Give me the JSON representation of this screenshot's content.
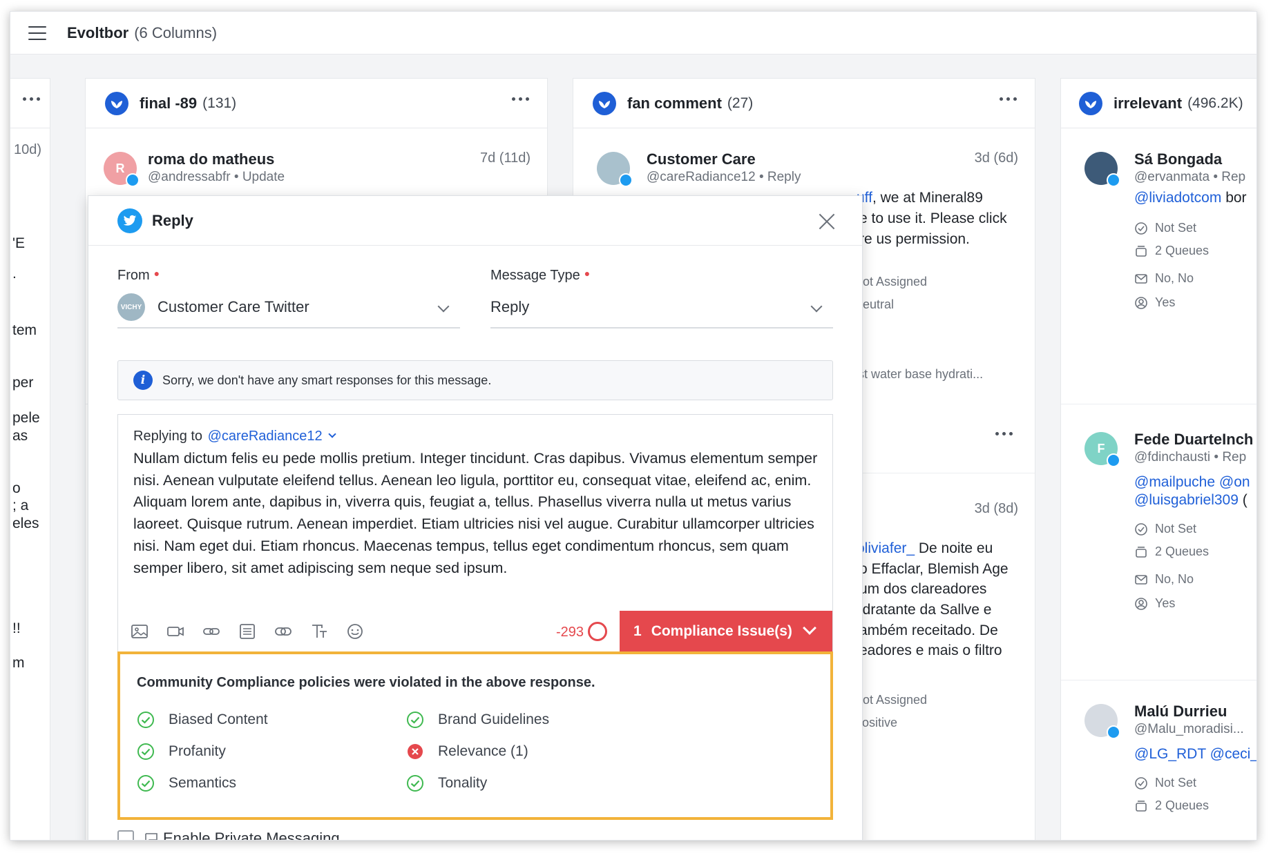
{
  "header": {
    "title": "Evoltbor",
    "subtitle": "(6 Columns)"
  },
  "left_column": {
    "time": "10d)",
    "fragments": [
      "'E",
      ".",
      "tem",
      "per",
      "pele",
      "as",
      "o",
      "; a",
      "eles",
      "!!",
      "m"
    ]
  },
  "columns": [
    {
      "title": "final -89",
      "count": "(131)",
      "cards": [
        {
          "initial": "R",
          "name": "roma do matheus",
          "handle": "@andressabfr • Update",
          "time": "7d (11d)"
        }
      ]
    },
    {
      "title": "fan comment",
      "count": "(27)",
      "cards": [
        {
          "name": "Customer Care",
          "handle": "@careRadiance12 • Reply",
          "time": "3d (6d)",
          "lines": [
            {
              "link": "uff",
              "text": ", we at Mineral89"
            },
            {
              "text": "e to use it. Please click"
            },
            {
              "text": "re us permission."
            }
          ],
          "assignment": "Not Assigned",
          "sentiment": "Neutral",
          "preview": "rst water base hydrati..."
        },
        {
          "time": "3d (8d)",
          "lines": [
            {
              "link": "oliviafer_",
              "text": " De noite eu"
            },
            {
              "text": "o Effaclar, Blemish Age"
            },
            {
              "text": "um dos clareadores"
            },
            {
              "text": "idratante da Sallve e"
            },
            {
              "text": "ambém receitado. De"
            },
            {
              "text": "eadores e mais o filtro"
            }
          ],
          "assignment": "Not Assigned",
          "sentiment": "Positive"
        }
      ]
    },
    {
      "title": "irrelevant",
      "count": "(496.2K)",
      "cards": [
        {
          "name": "Sá Bongada",
          "handle": "@ervanmata • Rep",
          "line1_link": "@liviadotcom",
          "line1_text": " bor",
          "status": "Not Set",
          "queues": "2 Queues",
          "flags": "No, No",
          "answer": "Yes"
        },
        {
          "initial": "F",
          "name": "Fede DuarteInch",
          "handle": "@fdinchausti • Rep",
          "line1_link": "@mailpuche @on",
          "line2_link": "@luisgabriel309",
          "line2_text": " (",
          "status": "Not Set",
          "queues": "2 Queues",
          "flags": "No, No",
          "answer": "Yes"
        },
        {
          "name": "Malú Durrieu",
          "handle": "@Malu_moradisi...",
          "line1_link": "@LG_RDT @ceci_",
          "status": "Not Set",
          "queues": "2 Queues"
        }
      ]
    }
  ],
  "reply_modal": {
    "title": "Reply",
    "from_label": "From",
    "from_value": "Customer Care Twitter",
    "account_avatar_text": "VICHY",
    "message_type_label": "Message Type",
    "message_type_value": "Reply",
    "info_text": "Sorry, we don't have any smart responses for this message.",
    "replying_to_label": "Replying to",
    "replying_to_handle": "@careRadiance12",
    "body": "Nullam dictum felis eu pede mollis pretium. Integer tincidunt. Cras dapibus. Vivamus elementum semper nisi. Aenean vulputate eleifend tellus. Aenean leo ligula, porttitor eu, consequat vitae, eleifend ac, enim. Aliquam lorem ante, dapibus in, viverra quis, feugiat a, tellus. Phasellus viverra nulla ut metus varius laoreet. Quisque rutrum. Aenean imperdiet. Etiam ultricies nisi vel augue. Curabitur ullamcorper ultricies nisi. Nam eget dui. Etiam rhoncus. Maecenas tempus, tellus eget condimentum rhoncus, sem quam semper libero, sit amet adipiscing sem neque sed ipsum.",
    "char_count": "-293",
    "compliance_count": "1",
    "compliance_label": "Compliance Issue(s)",
    "compliance_title": "Community Compliance policies were violated in the above response.",
    "checks": [
      {
        "label": "Biased Content",
        "status": "pass"
      },
      {
        "label": "Brand Guidelines",
        "status": "pass"
      },
      {
        "label": "Profanity",
        "status": "pass"
      },
      {
        "label": "Relevance (1)",
        "status": "fail"
      },
      {
        "label": "Semantics",
        "status": "pass"
      },
      {
        "label": "Tonality",
        "status": "pass"
      }
    ],
    "private_messaging_label": "Enable Private Messaging"
  },
  "colors": {
    "accent": "#2060d8",
    "brand": "#1f5fd6",
    "twitter": "#1d9bf0",
    "error": "#e5484d",
    "success": "#3fb950",
    "highlight": "#f2b33a"
  }
}
